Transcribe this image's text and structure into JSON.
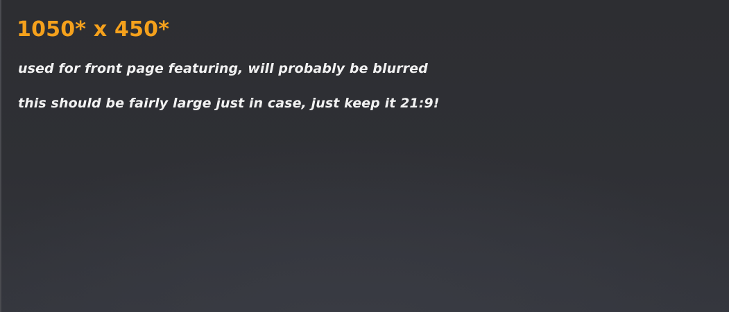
{
  "banner": {
    "title": "1050* x 450*",
    "lines": [
      "used for front page featuring, will probably be blurred",
      "this should be fairly large just in case, just keep it 21:9!"
    ]
  },
  "colors": {
    "title": "#f5a11c",
    "text": "#f2f2f2",
    "background": "#2e2f34"
  }
}
